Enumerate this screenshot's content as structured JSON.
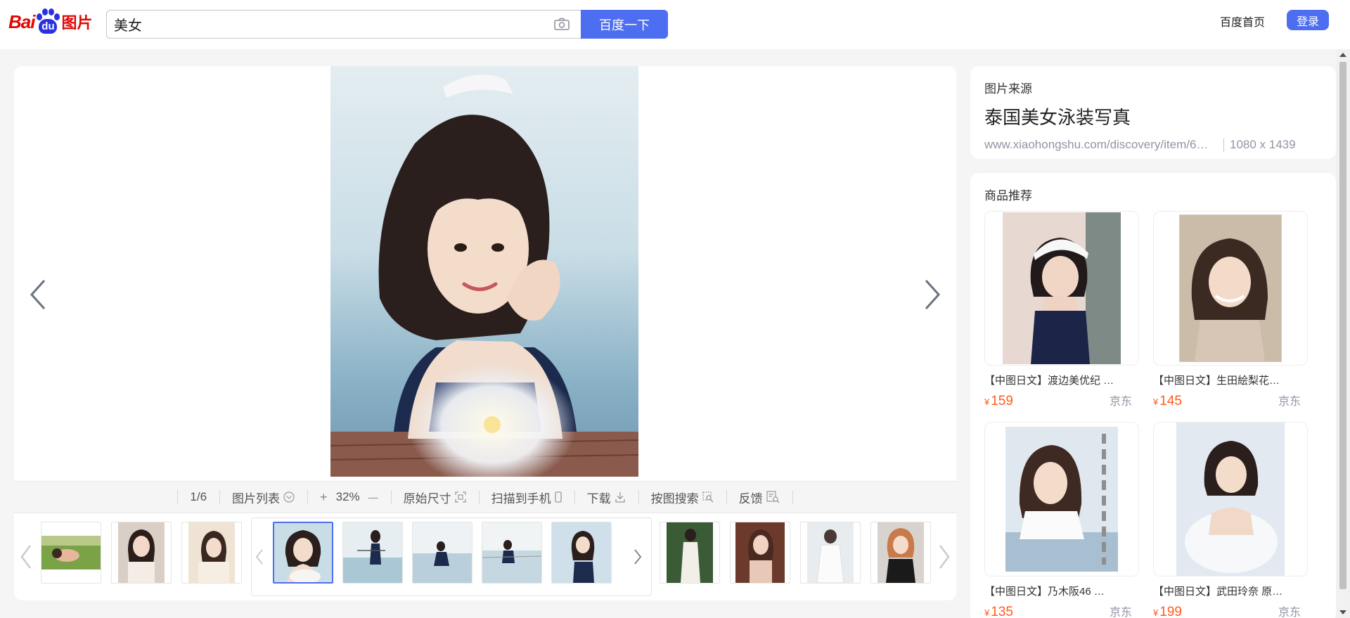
{
  "header": {
    "logo": {
      "text_bai": "Bai",
      "text_du": "du",
      "text_tupian": "图片",
      "brand_red": "#e10601",
      "brand_blue": "#2932e1"
    },
    "search": {
      "value": "美女",
      "camera_icon": "camera-icon"
    },
    "search_button": "百度一下",
    "home_link": "百度首页",
    "login_button": "登录",
    "accent": "#4e6ef2"
  },
  "viewer": {
    "image_alt": "Girl in swimsuit by the water",
    "toolbar": {
      "counter": "1/6",
      "list": "图片列表",
      "zoom_in": "+",
      "zoom": "32%",
      "zoom_out": "—",
      "original_size": "原始尺寸",
      "scan_to_phone": "扫描到手机",
      "download": "下载",
      "search_by_image": "按图搜索",
      "feedback": "反馈"
    },
    "thumbnails": {
      "previous_group": [
        {
          "scene": "meadow"
        },
        {
          "scene": "portrait-a"
        },
        {
          "scene": "portrait-b"
        }
      ],
      "current_group": [
        {
          "scene": "main",
          "selected": true
        },
        {
          "scene": "pool-a"
        },
        {
          "scene": "pool-b"
        },
        {
          "scene": "pool-c"
        },
        {
          "scene": "pool-d"
        }
      ],
      "next_group": [
        {
          "scene": "forest"
        },
        {
          "scene": "room-a"
        },
        {
          "scene": "room-b"
        },
        {
          "scene": "room-c"
        }
      ]
    }
  },
  "source": {
    "label": "图片来源",
    "title": "泰国美女泳装写真",
    "url": "www.xiaohongshu.com/discovery/item/6…",
    "dimensions": "1080 x 1439"
  },
  "products": {
    "title": "商品推荐",
    "currency": "¥",
    "items": [
      {
        "name": "【中图日文】渡边美优纪 …",
        "price": "159",
        "shop": "京东"
      },
      {
        "name": "【中图日文】生田絵梨花…",
        "price": "145",
        "shop": "京东"
      },
      {
        "name": "【中图日文】乃木阪46 …",
        "price": "135",
        "shop": "京东"
      },
      {
        "name": "【中图日文】武田玲奈 原…",
        "price": "199",
        "shop": "京东"
      }
    ]
  }
}
